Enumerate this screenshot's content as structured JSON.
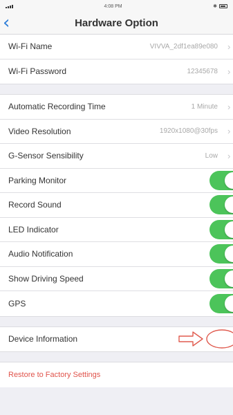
{
  "status_bar": {
    "time": "4:08 PM"
  },
  "header": {
    "back_icon": "chevron-left-icon",
    "title": "Hardware Option"
  },
  "wifi": {
    "name_label": "Wi-Fi Name",
    "name_value": "VIVVA_2df1ea89e080",
    "password_label": "Wi-Fi Password",
    "password_value": "12345678"
  },
  "recording": {
    "auto_time_label": "Automatic Recording Time",
    "auto_time_value": "1 Minute",
    "resolution_label": "Video Resolution",
    "resolution_value": "1920x1080@30fps",
    "gsensor_label": "G-Sensor Sensibility",
    "gsensor_value": "Low"
  },
  "toggles": [
    {
      "label": "Parking Monitor",
      "on": true
    },
    {
      "label": "Record Sound",
      "on": true
    },
    {
      "label": "LED Indicator",
      "on": true
    },
    {
      "label": "Audio Notification",
      "on": true
    },
    {
      "label": "Show Driving Speed",
      "on": true
    },
    {
      "label": "GPS",
      "on": true
    }
  ],
  "device_info": {
    "label": "Device Information"
  },
  "restore": {
    "label": "Restore to Factory Settings"
  },
  "colors": {
    "toggle_on": "#4cc45a",
    "accent": "#2f7fd8",
    "annotation": "#e05a4e",
    "restore_text": "#e0534b"
  }
}
